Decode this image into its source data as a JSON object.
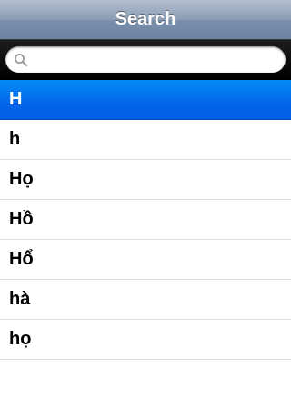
{
  "navbar": {
    "title": "Search"
  },
  "search": {
    "placeholder": "",
    "value": "",
    "icon": "search-icon"
  },
  "results": {
    "selected_index": 0,
    "items": [
      {
        "label": "H"
      },
      {
        "label": "h"
      },
      {
        "label": "Họ"
      },
      {
        "label": "Hồ"
      },
      {
        "label": "Hổ"
      },
      {
        "label": "hà"
      },
      {
        "label": "họ"
      }
    ]
  },
  "colors": {
    "navbar_top": "#b2bfcf",
    "navbar_bottom": "#6d83a1",
    "searchbar": "#000000",
    "selection": "#0466e8",
    "separator": "#e0e0e0"
  }
}
